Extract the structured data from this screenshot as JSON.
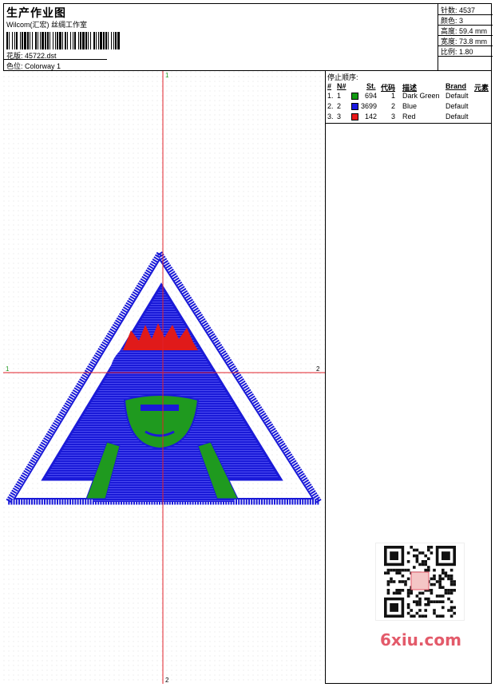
{
  "header": {
    "title": "生产作业图",
    "subtitle": "Wilcom(汇宏) 丝绸工作室",
    "design_label": "花版: 45722.dst",
    "colorway_label": "色位: Colorway 1"
  },
  "stats": {
    "stitches": "针数: 4537",
    "colors": "颜色: 3",
    "height": "高度: 59.4 mm",
    "width": "宽度: 73.8 mm",
    "scale": "比例: 1.80"
  },
  "axis": {
    "top": "1",
    "bottom": "2",
    "left": "1",
    "right": "2"
  },
  "stop_sequence": {
    "label": "停止顺序:",
    "headers": [
      "#",
      "N#",
      "St.",
      "代码",
      "描述",
      "Brand",
      "元素"
    ],
    "rows": [
      {
        "idx": "1.",
        "n": "1",
        "st": "694",
        "code": "1",
        "desc": "Dark Green",
        "brand": "Default",
        "color": "#109a10"
      },
      {
        "idx": "2.",
        "n": "2",
        "st": "3699",
        "code": "2",
        "desc": "Blue",
        "brand": "Default",
        "color": "#1818e0"
      },
      {
        "idx": "3.",
        "n": "3",
        "st": "142",
        "code": "3",
        "desc": "Red",
        "brand": "Default",
        "color": "#e81818"
      }
    ]
  },
  "colors": {
    "green": "#1f9a1f",
    "blue": "#1a1ad8",
    "red": "#e01a1a",
    "guide": "#e0202a"
  },
  "watermark": "6xiu.com"
}
